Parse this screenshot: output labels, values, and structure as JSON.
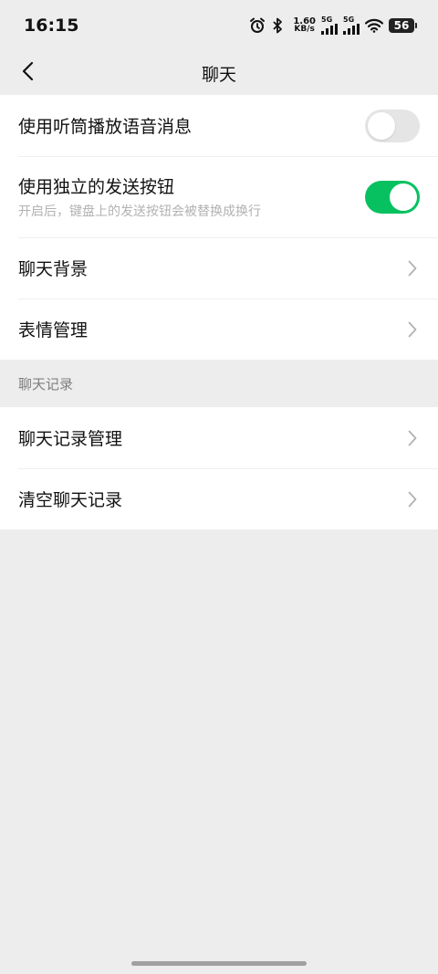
{
  "status_bar": {
    "time": "16:15",
    "net_speed_value": "1.60",
    "net_speed_unit": "KB/s",
    "sim1_label": "5G",
    "sim2_label": "5G",
    "battery_level": "56",
    "icons": [
      "alarm-icon",
      "bluetooth-icon",
      "signal-icon",
      "wifi-icon",
      "battery-icon"
    ]
  },
  "nav": {
    "title": "聊天",
    "back_icon": "chevron-left-icon"
  },
  "settings": {
    "earpiece": {
      "label": "使用听筒播放语音消息",
      "enabled": false
    },
    "send_button": {
      "label": "使用独立的发送按钮",
      "description": "开启后，键盘上的发送按钮会被替换成换行",
      "enabled": true
    },
    "background": {
      "label": "聊天背景"
    },
    "stickers": {
      "label": "表情管理"
    }
  },
  "history": {
    "section_title": "聊天记录",
    "manage": {
      "label": "聊天记录管理"
    },
    "clear": {
      "label": "清空聊天记录"
    }
  },
  "colors": {
    "accent": "#07c160",
    "page_bg": "#ededed",
    "card_bg": "#ffffff",
    "toggle_off": "#e5e5e5",
    "secondary_text": "#b2b2b2"
  }
}
